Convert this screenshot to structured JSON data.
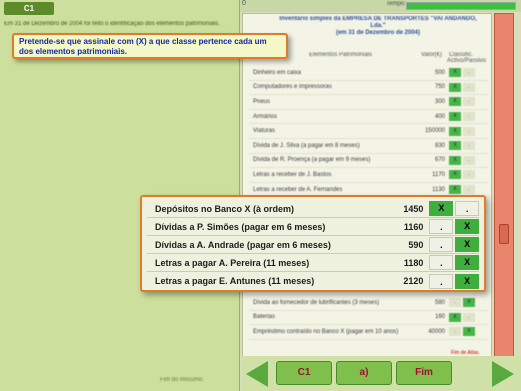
{
  "left_panel": {
    "tab": "C1",
    "intro_text": "Em 31 de Dezembro de 2004 foi feito o identificação dos elementos patrimoniais.",
    "footer": "Fim do Resumo."
  },
  "top_bar": {
    "number": "0",
    "tempo_label": "Tempo:",
    "timer_fraction": 1.0
  },
  "document": {
    "title_lines": [
      "Inventário simples da EMPRESA DE TRANSPORTES \"VAI ANDANDO,",
      "Lda.\"",
      "(em 31 de Dezembro de 2004)"
    ],
    "header": {
      "label": "Elementos Patrimoniais",
      "value": "Valor(€)",
      "class": "Classific. Activo/Passivo"
    },
    "rows": [
      {
        "label": "Dinheiro em caixa",
        "value": "500",
        "a": "X",
        "p": "."
      },
      {
        "label": "Computadores e impressoras",
        "value": "750",
        "a": "X",
        "p": "."
      },
      {
        "label": "Pneus",
        "value": "300",
        "a": "X",
        "p": "."
      },
      {
        "label": "Armários",
        "value": "400",
        "a": "X",
        "p": "."
      },
      {
        "label": "Viaturas",
        "value": "150000",
        "a": "X",
        "p": "."
      },
      {
        "label": "Dívida de J. Silva (a pagar em 8 meses)",
        "value": "830",
        "a": "X",
        "p": "."
      },
      {
        "label": "Dívida de R. Proença (a pagar em 9 meses)",
        "value": "670",
        "a": "X",
        "p": "."
      },
      {
        "label": "Letras a receber de J. Bastos",
        "value": "1170",
        "a": "X",
        "p": "."
      },
      {
        "label": "Letras a receber de A. Fernandes",
        "value": "1130",
        "a": "X",
        "p": "."
      },
      {
        "label": "Secretárias",
        "value": "380",
        "a": "X",
        "p": "."
      }
    ],
    "rows_bottom": [
      {
        "label": "Dívida ao fornecedor de lubrificantes (3 meses)",
        "value": "580",
        "a": ".",
        "p": "X"
      },
      {
        "label": "Baterias",
        "value": "160",
        "a": "X",
        "p": "."
      },
      {
        "label": "Empréstimo contraído no Banco X (pagar em 10 anos)",
        "value": "40000",
        "a": ".",
        "p": "X"
      }
    ],
    "footer": "Fim de Atlas."
  },
  "instruction": "Pretende-se que assinale com (X) a que classe pertence cada um dos elementos patrimoniais.",
  "popup_rows": [
    {
      "label": "Depósitos no Banco X (à ordem)",
      "value": "1450",
      "a": "X",
      "p": ".",
      "a_on": true,
      "p_on": false
    },
    {
      "label": "Dívidas a P. Simões (pagar em 6 meses)",
      "value": "1160",
      "a": ".",
      "p": "X",
      "a_on": false,
      "p_on": true
    },
    {
      "label": "Dívidas a A. Andrade (pagar em 6 meses)",
      "value": "590",
      "a": ".",
      "p": "X",
      "a_on": false,
      "p_on": true
    },
    {
      "label": "Letras a pagar A. Pereira (11 meses)",
      "value": "1180",
      "a": ".",
      "p": "X",
      "a_on": false,
      "p_on": true
    },
    {
      "label": "Letras a pagar E. Antunes (11 meses)",
      "value": "2120",
      "a": ".",
      "p": "X",
      "a_on": false,
      "p_on": true
    }
  ],
  "nav": {
    "btn1": "C1",
    "btn2": "a)",
    "btn3": "Fim"
  },
  "colors": {
    "accent_orange": "#e07b2b",
    "check_green": "#3fae3f",
    "title_blue": "#14299b"
  }
}
